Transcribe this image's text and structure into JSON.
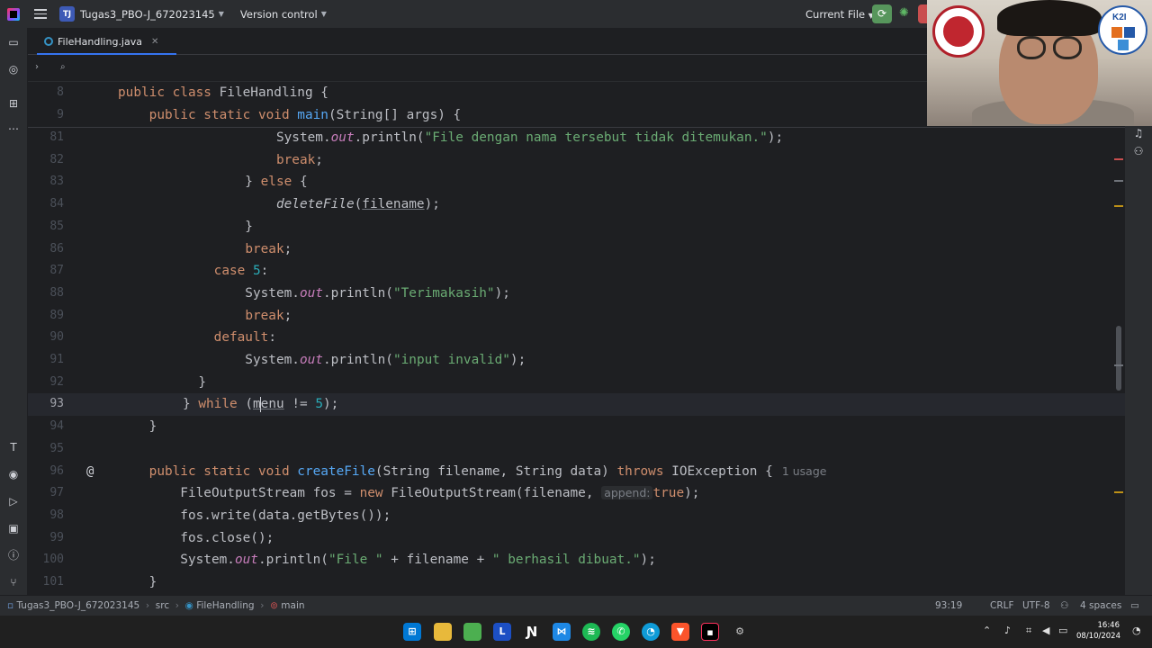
{
  "titlebar": {
    "project_badge": "TJ",
    "project_name": "Tugas3_PBO-J_672023145",
    "vcs": "Version control",
    "run_config": "Current File"
  },
  "tabs": [
    {
      "label": "FileHandling.java",
      "active": true
    }
  ],
  "editor": {
    "sticky_lines": [
      {
        "num": "8",
        "code": [
          [
            "kw",
            "public class "
          ],
          [
            "",
            "FileHandling {"
          ]
        ]
      },
      {
        "num": "9",
        "code": [
          [
            "",
            "    "
          ],
          [
            "kw",
            "public static void "
          ],
          [
            "fn",
            "main"
          ],
          [
            "",
            "(String[] args) {"
          ]
        ]
      }
    ],
    "lines": [
      {
        "num": "81",
        "code": [
          [
            "",
            "            System."
          ],
          [
            "fld",
            "out"
          ],
          [
            "",
            ".println("
          ],
          [
            "st",
            "\"File dengan nama tersebut tidak ditemukan.\""
          ],
          [
            "",
            ");"
          ]
        ]
      },
      {
        "num": "82",
        "code": [
          [
            "",
            "            "
          ],
          [
            "kw",
            "break"
          ],
          [
            "",
            ";"
          ]
        ]
      },
      {
        "num": "83",
        "code": [
          [
            "",
            "        } "
          ],
          [
            "kw",
            "else"
          ],
          [
            "",
            " {"
          ]
        ]
      },
      {
        "num": "84",
        "code": [
          [
            "",
            "            "
          ],
          [
            "sfn",
            "deleteFile"
          ],
          [
            "",
            "("
          ],
          [
            "ul",
            "filename"
          ],
          [
            "",
            ");"
          ]
        ]
      },
      {
        "num": "85",
        "code": [
          [
            "",
            "        }"
          ]
        ]
      },
      {
        "num": "86",
        "code": [
          [
            "",
            "        "
          ],
          [
            "kw",
            "break"
          ],
          [
            "",
            ";"
          ]
        ]
      },
      {
        "num": "87",
        "code": [
          [
            "",
            "    "
          ],
          [
            "kw",
            "case "
          ],
          [
            "num",
            "5"
          ],
          [
            "",
            ":"
          ]
        ]
      },
      {
        "num": "88",
        "code": [
          [
            "",
            "        System."
          ],
          [
            "fld",
            "out"
          ],
          [
            "",
            ".println("
          ],
          [
            "st",
            "\"Terimakasih\""
          ],
          [
            "",
            ");"
          ]
        ]
      },
      {
        "num": "89",
        "code": [
          [
            "",
            "        "
          ],
          [
            "kw",
            "break"
          ],
          [
            "",
            ";"
          ]
        ]
      },
      {
        "num": "90",
        "code": [
          [
            "",
            "    "
          ],
          [
            "kw",
            "default"
          ],
          [
            "",
            ":"
          ]
        ]
      },
      {
        "num": "91",
        "code": [
          [
            "",
            "        System."
          ],
          [
            "fld",
            "out"
          ],
          [
            "",
            ".println("
          ],
          [
            "st",
            "\"input invalid\""
          ],
          [
            "",
            ");"
          ]
        ]
      },
      {
        "num": "92",
        "code": [
          [
            "",
            "  }"
          ]
        ]
      },
      {
        "num": "93",
        "code": [
          [
            "",
            "} "
          ],
          [
            "kw",
            "while"
          ],
          [
            "",
            " ("
          ],
          [
            "caret",
            "menu"
          ],
          [
            "",
            " != "
          ],
          [
            "num",
            "5"
          ],
          [
            "",
            ");"
          ]
        ],
        "current": true
      },
      {
        "num": "94",
        "code": [
          [
            "",
            "    }"
          ]
        ]
      },
      {
        "num": "95",
        "code": []
      },
      {
        "num": "96",
        "code": [
          [
            "",
            "    "
          ],
          [
            "kw",
            "public static void "
          ],
          [
            "fn",
            "createFile"
          ],
          [
            "",
            "(String filename, String data) "
          ],
          [
            "kw",
            "throws "
          ],
          [
            "",
            "IOException {"
          ],
          [
            "usage",
            "1 usage"
          ]
        ],
        "at_marker": "@"
      },
      {
        "num": "97",
        "code": [
          [
            "",
            "        FileOutputStream fos = "
          ],
          [
            "kw",
            "new "
          ],
          [
            "",
            "FileOutputStream(filename, "
          ],
          [
            "hint",
            "append:"
          ],
          [
            "kw",
            "true"
          ],
          [
            "",
            ");"
          ]
        ]
      },
      {
        "num": "98",
        "code": [
          [
            "",
            "        fos.write(data.getBytes());"
          ]
        ]
      },
      {
        "num": "99",
        "code": [
          [
            "",
            "        fos.close();"
          ]
        ]
      },
      {
        "num": "100",
        "code": [
          [
            "",
            "        System."
          ],
          [
            "fld",
            "out"
          ],
          [
            "",
            ".println("
          ],
          [
            "st",
            "\"File \""
          ],
          [
            "",
            " + filename + "
          ],
          [
            "st",
            "\" berhasil dibuat.\""
          ],
          [
            "",
            ");"
          ]
        ]
      },
      {
        "num": "101",
        "code": [
          [
            "",
            "    }"
          ]
        ]
      }
    ]
  },
  "statusbar": {
    "crumbs": [
      "Tugas3_PBO-J_672023145",
      "src",
      "FileHandling",
      "main"
    ],
    "position": "93:19",
    "line_sep": "CRLF",
    "encoding": "UTF-8",
    "indent": "4 spaces"
  },
  "taskbar": {
    "time": "16:46",
    "date": "08/10/2024"
  },
  "webcam": {
    "logo_right_text": "K2I"
  },
  "colors": {
    "accent": "#3574f0",
    "keyword": "#cf8e6d",
    "function": "#56a8f5",
    "string": "#6aab73",
    "number": "#2aacb8",
    "field": "#c77dbb"
  }
}
